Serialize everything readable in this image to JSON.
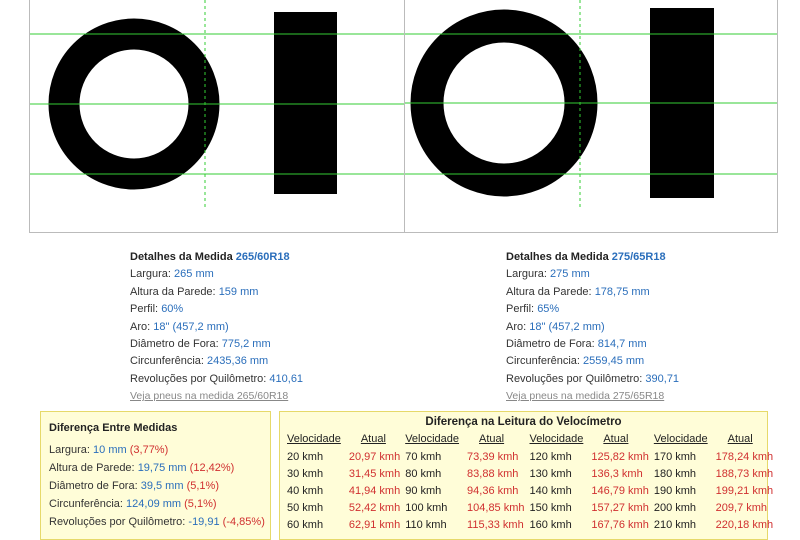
{
  "colors": {
    "guide_line": "#33cc33",
    "tire": "#000000",
    "value_blue": "#2a6ebb",
    "value_red": "#d03030",
    "box_bg": "#fffdd8"
  },
  "tires": [
    {
      "title_label": "Detalhes da Medida",
      "size": "265/60R18",
      "rows": [
        {
          "label": "Largura:",
          "value": "265 mm"
        },
        {
          "label": "Altura da Parede:",
          "value": "159 mm"
        },
        {
          "label": "Perfil:",
          "value": "60%"
        },
        {
          "label": "Aro:",
          "value": "18\" (457,2 mm)"
        },
        {
          "label": "Diâmetro de Fora:",
          "value": "775,2 mm"
        },
        {
          "label": "Circunferência:",
          "value": "2435,36 mm"
        },
        {
          "label": "Revoluções por Quilômetro:",
          "value": "410,61"
        }
      ],
      "link": "Veja pneus na medida 265/60R18"
    },
    {
      "title_label": "Detalhes da Medida",
      "size": "275/65R18",
      "rows": [
        {
          "label": "Largura:",
          "value": "275 mm"
        },
        {
          "label": "Altura da Parede:",
          "value": "178,75 mm"
        },
        {
          "label": "Perfil:",
          "value": "65%"
        },
        {
          "label": "Aro:",
          "value": "18\" (457,2 mm)"
        },
        {
          "label": "Diâmetro de Fora:",
          "value": "814,7 mm"
        },
        {
          "label": "Circunferência:",
          "value": "2559,45 mm"
        },
        {
          "label": "Revoluções por Quilômetro:",
          "value": "390,71"
        }
      ],
      "link": "Veja pneus na medida 275/65R18"
    }
  ],
  "difference": {
    "title": "Diferença Entre Medidas",
    "rows": [
      {
        "label": "Largura:",
        "value": "10 mm",
        "pct": "(3,77%)"
      },
      {
        "label": "Altura de Parede:",
        "value": "19,75 mm",
        "pct": "(12,42%)"
      },
      {
        "label": "Diâmetro de Fora:",
        "value": "39,5 mm",
        "pct": "(5,1%)"
      },
      {
        "label": "Circunferência:",
        "value": "124,09 mm",
        "pct": "(5,1%)"
      },
      {
        "label": "Revoluções por Quilômetro:",
        "value": "-19,91",
        "pct": "(-4,85%)"
      }
    ]
  },
  "speedometer": {
    "title": "Diferença na Leitura do Velocímetro",
    "headers": [
      "Velocidade",
      "Atual"
    ],
    "columns": [
      [
        [
          "20 kmh",
          "20,97 kmh"
        ],
        [
          "30 kmh",
          "31,45 kmh"
        ],
        [
          "40 kmh",
          "41,94 kmh"
        ],
        [
          "50 kmh",
          "52,42 kmh"
        ],
        [
          "60 kmh",
          "62,91 kmh"
        ]
      ],
      [
        [
          "70 kmh",
          "73,39 kmh"
        ],
        [
          "80 kmh",
          "83,88 kmh"
        ],
        [
          "90 kmh",
          "94,36 kmh"
        ],
        [
          "100 kmh",
          "104,85 kmh"
        ],
        [
          "110 kmh",
          "115,33 kmh"
        ]
      ],
      [
        [
          "120 kmh",
          "125,82 kmh"
        ],
        [
          "130 kmh",
          "136,3 kmh"
        ],
        [
          "140 kmh",
          "146,79 kmh"
        ],
        [
          "150 kmh",
          "157,27 kmh"
        ],
        [
          "160 kmh",
          "167,76 kmh"
        ]
      ],
      [
        [
          "170 kmh",
          "178,24 kmh"
        ],
        [
          "180 kmh",
          "188,73 kmh"
        ],
        [
          "190 kmh",
          "199,21 kmh"
        ],
        [
          "200 kmh",
          "209,7 kmh"
        ],
        [
          "210 kmh",
          "220,18 kmh"
        ]
      ]
    ]
  }
}
